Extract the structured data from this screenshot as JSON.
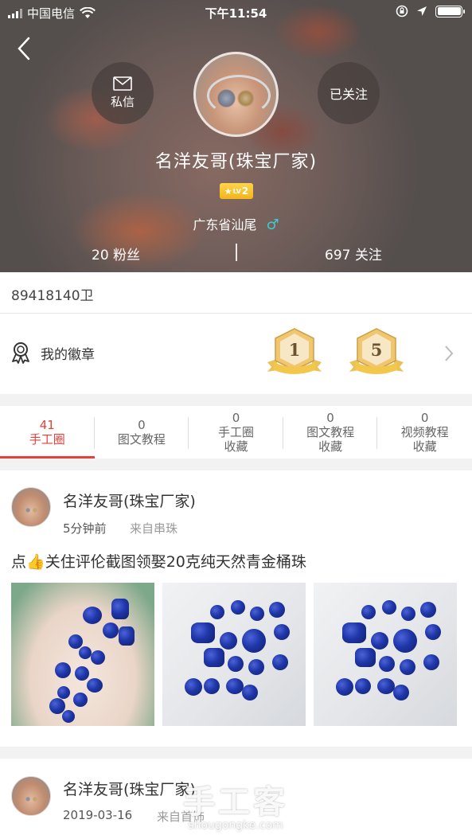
{
  "status_bar": {
    "carrier": "中国电信",
    "time": "下午11:54"
  },
  "profile": {
    "message_label": "私信",
    "follow_label": "已关注",
    "name": "名洋友哥(珠宝厂家)",
    "level": "2",
    "level_prefix": "LV",
    "location": "广东省汕尾",
    "gender_symbol": "♂",
    "fans": "20 粉丝",
    "following": "697 关注"
  },
  "user_id": "89418140卫",
  "badges": {
    "label": "我的徽章",
    "items": [
      "1",
      "5"
    ]
  },
  "tabs": [
    {
      "count": "41",
      "label": "手工圈",
      "active": true
    },
    {
      "count": "0",
      "label": "图文教程",
      "active": false
    },
    {
      "count": "0",
      "label": "手工圈\n收藏",
      "line1": "手工圈",
      "line2": "收藏",
      "active": false
    },
    {
      "count": "0",
      "label": "图文教程\n收藏",
      "line1": "图文教程",
      "line2": "收藏",
      "active": false
    },
    {
      "count": "0",
      "label": "视频教程\n收藏",
      "line1": "视频教程",
      "line2": "收藏",
      "active": false
    }
  ],
  "posts": [
    {
      "author": "名洋友哥(珠宝厂家)",
      "time": "5分钟前",
      "source": "来自串珠",
      "text_prefix": "点",
      "text_icon": "thumbs-up-emoji",
      "text": "关住评伦截图领娶20克纯天然青金桶珠"
    },
    {
      "author": "名洋友哥(珠宝厂家)",
      "time": "2019-03-16",
      "source": "来自首饰"
    }
  ],
  "watermark": {
    "main": "手工客",
    "sub": "shougongke.com"
  },
  "colors": {
    "accent": "#e5403b",
    "gender": "#3ccbd3",
    "level_badge": "#f3b51b",
    "bead_blue": "#1f36a8"
  }
}
